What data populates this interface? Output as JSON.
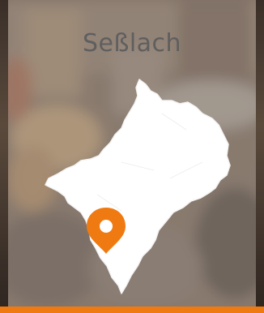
{
  "card": {
    "title": "Seßlach",
    "accent_color": "#f07a12",
    "map_fill_color": "#ffffff",
    "marker_icon": "location-pin-icon"
  }
}
